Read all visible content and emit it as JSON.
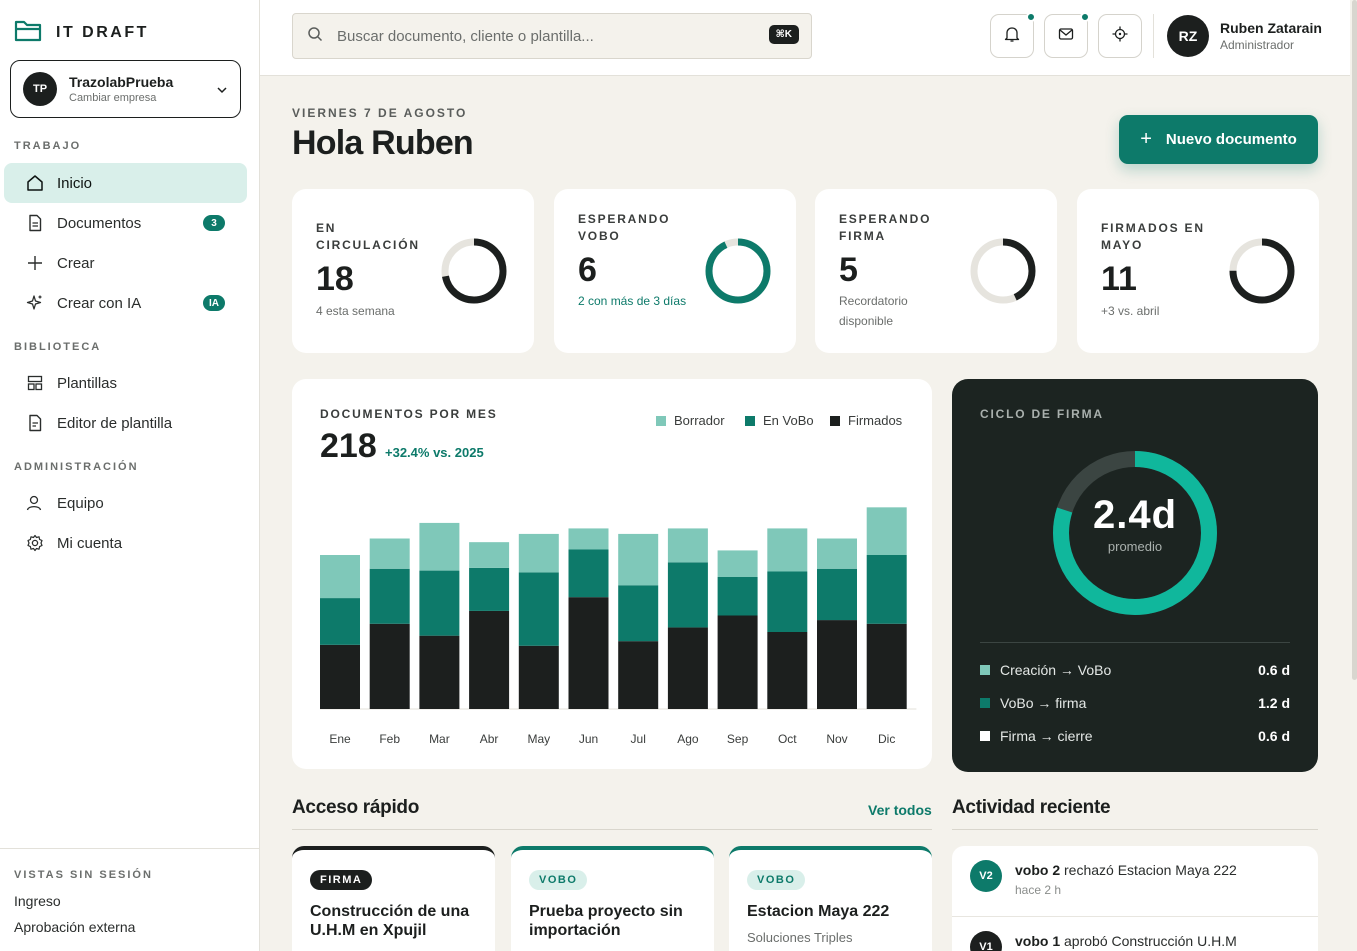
{
  "brand": {
    "name": "IT DRAFT"
  },
  "company": {
    "initials": "TP",
    "name": "TrazolabPrueba",
    "action": "Cambiar empresa"
  },
  "sidebar": {
    "sections": [
      "TRABAJO",
      "BIBLIOTECA",
      "ADMINISTRACIÓN"
    ],
    "items": [
      {
        "label": "Inicio",
        "icon": "home-icon"
      },
      {
        "label": "Documentos",
        "icon": "document-icon",
        "badge": "3"
      },
      {
        "label": "Crear",
        "icon": "plus-icon"
      },
      {
        "label": "Crear con IA",
        "icon": "sparkle-icon",
        "badge": "IA"
      },
      {
        "label": "Plantillas",
        "icon": "templates-icon"
      },
      {
        "label": "Editor de plantilla",
        "icon": "document-edit-icon"
      },
      {
        "label": "Equipo",
        "icon": "user-icon"
      },
      {
        "label": "Mi cuenta",
        "icon": "gear-icon"
      }
    ],
    "footer_label": "VISTAS SIN SESIÓN",
    "footer_links": [
      "Ingreso",
      "Aprobación externa"
    ]
  },
  "search": {
    "placeholder": "Buscar documento, cliente o plantilla...",
    "shortcut": "⌘K"
  },
  "user": {
    "initials": "RZ",
    "name": "Ruben Zatarain",
    "role": "Administrador"
  },
  "header": {
    "date": "VIERNES 7 DE AGOSTO",
    "greeting": "Hola Ruben",
    "new_doc_label": "Nuevo documento"
  },
  "stats": [
    {
      "label": "EN CIRCULACIÓN",
      "value": "18",
      "note": "4 esta semana",
      "fraction": 0.72,
      "color": "#1c1f1e"
    },
    {
      "label": "ESPERANDO VOBO",
      "value": "6",
      "note": "2 con más de 3 días",
      "fraction": 0.93,
      "color": "#0d7a6a"
    },
    {
      "label": "ESPERANDO FIRMA",
      "value": "5",
      "note": "Recordatorio disponible",
      "fraction": 0.43,
      "color": "#1c1f1e"
    },
    {
      "label": "FIRMADOS EN MAYO",
      "value": "11",
      "note": "+3 vs. abril",
      "fraction": 0.75,
      "color": "#1c1f1e"
    }
  ],
  "chart_data": {
    "type": "bar",
    "stacked": true,
    "title": "DOCUMENTOS POR MES",
    "total": "218",
    "delta": "+32.4% vs. 2025",
    "categories": [
      "Ene",
      "Feb",
      "Mar",
      "Abr",
      "May",
      "Jun",
      "Jul",
      "Ago",
      "Sep",
      "Oct",
      "Nov",
      "Dic"
    ],
    "series": [
      {
        "name": "Firmados",
        "color": "#1c1f1e",
        "values": [
          70,
          93,
          80,
          107,
          69,
          122,
          74,
          89,
          102,
          84,
          97,
          93
        ]
      },
      {
        "name": "En VoBo",
        "color": "#0d7a6a",
        "values": [
          51,
          60,
          71,
          47,
          80,
          52,
          61,
          71,
          42,
          66,
          56,
          75
        ]
      },
      {
        "name": "Borrador",
        "color": "#7fc8b9",
        "values": [
          47,
          33,
          52,
          28,
          42,
          23,
          56,
          37,
          29,
          47,
          33,
          52
        ]
      }
    ],
    "legend_order": [
      "Borrador",
      "En VoBo",
      "Firmados"
    ],
    "ylim": [
      0,
      240
    ],
    "grid": false,
    "legend_position": "top-right"
  },
  "cycle": {
    "title": "CICLO DE FIRMA",
    "value": "2.4d",
    "sub": "promedio",
    "fraction": 0.8,
    "rows": [
      {
        "label": "Creación → VoBo",
        "value": "0.6 d",
        "color": "#7fc8b9"
      },
      {
        "label": "VoBo → firma",
        "value": "1.2 d",
        "color": "#0d7a6a"
      },
      {
        "label": "Firma → cierre",
        "value": "0.6 d",
        "color": "#ffffff"
      }
    ]
  },
  "quick": {
    "title": "Acceso rápido",
    "see_all": "Ver todos",
    "cards": [
      {
        "tag": "FIRMA",
        "title": "Construcción de una U.H.M en Xpujil",
        "sub": ""
      },
      {
        "tag": "VOBO",
        "title": "Prueba proyecto sin importación",
        "sub": ""
      },
      {
        "tag": "VOBO",
        "title": "Estacion Maya 222",
        "sub": "Soluciones Triples"
      }
    ]
  },
  "activity": {
    "title": "Actividad reciente",
    "items": [
      {
        "initials": "V2",
        "actor": "vobo 2",
        "text": "rechazó Estacion Maya 222",
        "time": "hace 2 h",
        "color": "#0d7a6a"
      },
      {
        "initials": "V1",
        "actor": "vobo 1",
        "text": "aprobó Construcción U.H.M",
        "time": "",
        "color": "#1c1f1e"
      }
    ]
  }
}
